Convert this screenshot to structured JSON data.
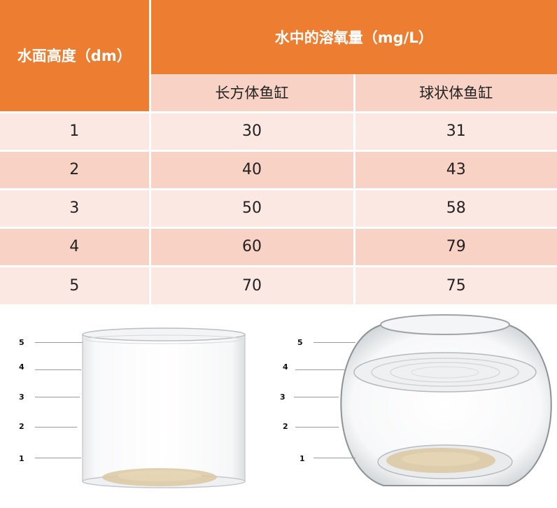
{
  "table": {
    "header_height": "水面高度（dm）",
    "header_oxygen": "水中的溶氧量（mg/L）",
    "col_rect": "长方体鱼缸",
    "col_round": "球状体鱼缸",
    "rows": [
      {
        "h": "1",
        "rect": "30",
        "round": "31"
      },
      {
        "h": "2",
        "rect": "40",
        "round": "43"
      },
      {
        "h": "3",
        "rect": "50",
        "round": "58"
      },
      {
        "h": "4",
        "rect": "60",
        "round": "79"
      },
      {
        "h": "5",
        "rect": "70",
        "round": "75"
      }
    ]
  },
  "left_tank": {
    "levels": [
      "5",
      "4",
      "3",
      "2",
      "1"
    ]
  },
  "right_tank": {
    "levels": [
      "5",
      "4",
      "3",
      "2",
      "1"
    ]
  },
  "colors": {
    "header": "#ed7d31",
    "subheader": "#f8d2c4",
    "row_light": "#fce8e3",
    "row_dark": "#f8d2c4"
  }
}
